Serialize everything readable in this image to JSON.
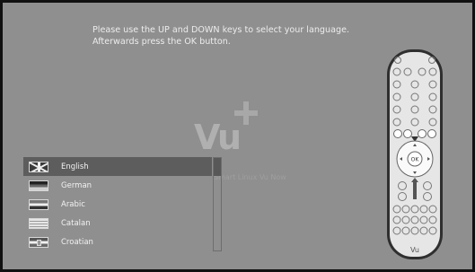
{
  "instructions": {
    "line1": "Please use the UP and DOWN keys to select your language.",
    "line2": "Afterwards press the OK button."
  },
  "logo": {
    "brand": "Vu",
    "tagline": "Smart Linux Vu Now"
  },
  "languages": [
    {
      "label": "English",
      "flag": "uk-flag-icon",
      "selected": true
    },
    {
      "label": "German",
      "flag": "germany-flag-icon",
      "selected": false
    },
    {
      "label": "Arabic",
      "flag": "arabic-flag-icon",
      "selected": false
    },
    {
      "label": "Catalan",
      "flag": "catalonia-flag-icon",
      "selected": false
    },
    {
      "label": "Croatian",
      "flag": "croatia-flag-icon",
      "selected": false
    }
  ],
  "remote": {
    "ok_label": "OK",
    "brand": "Vu",
    "icon": "remote-control-icon"
  },
  "colors": {
    "background": "#8f8f8f",
    "selection": "#5d5d5d",
    "text": "#f2f2f2"
  }
}
